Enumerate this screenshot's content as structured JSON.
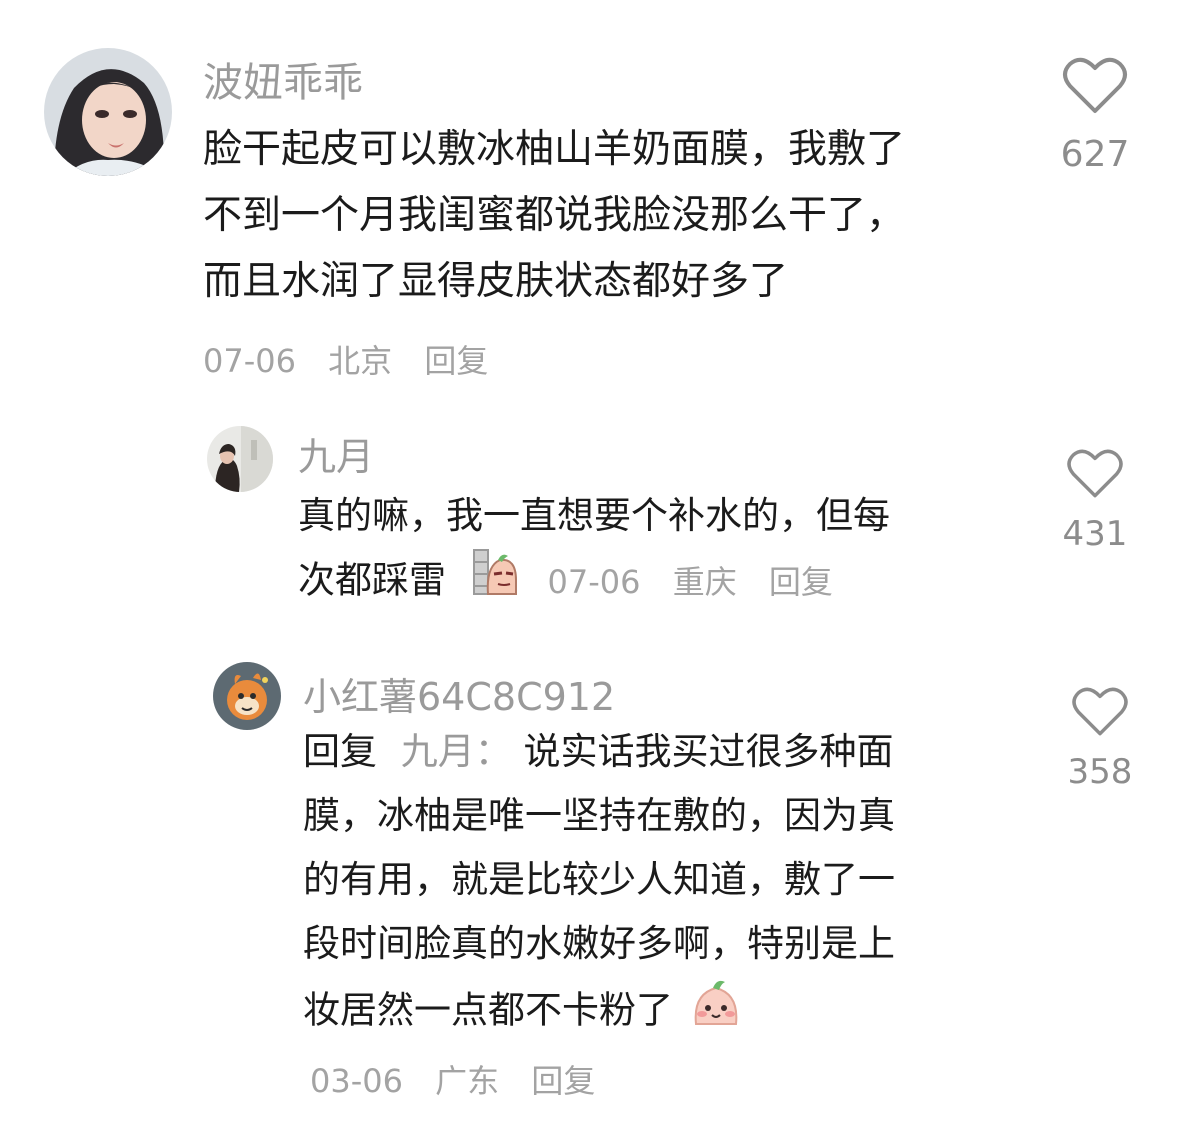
{
  "comments": [
    {
      "username": "波妞乖乖",
      "avatar_icon": "anime-girl-avatar-icon",
      "lines": [
        "脸干起皮可以敷冰柚山羊奶面膜，我敷了",
        "不到一个月我闺蜜都说我脸没那么干了，",
        "而且水润了显得皮肤状态都好多了"
      ],
      "date": "07-06",
      "location": "北京",
      "reply_label": "回复",
      "like_count": "627"
    },
    {
      "username": "九月",
      "avatar_icon": "photo-avatar-icon",
      "lines": [
        "真的嘛，我一直想要个补水的，但每",
        "次都踩雷"
      ],
      "emoji_icon": "peeking-wall-emoji-icon",
      "date": "07-06",
      "location": "重庆",
      "reply_label": "回复",
      "like_count": "431"
    },
    {
      "username": "小红薯64C8C912",
      "avatar_icon": "cartoon-mascot-avatar-icon",
      "reply_prefix": "回复",
      "reply_to": "九月：",
      "lines": [
        "说实话我买过很多种面",
        "膜，冰柚是唯一坚持在敷的，因为真",
        "的有用，就是比较少人知道，敷了一",
        "段时间脸真的水嫩好多啊，特别是上",
        "妆居然一点都不卡粉了"
      ],
      "emoji_icon": "blushing-face-emoji-icon",
      "date": "03-06",
      "location": "广东",
      "reply_label": "回复",
      "like_count": "358"
    }
  ],
  "colors": {
    "text": "#1b1b1b",
    "username": "#9a9a9a",
    "meta": "#a3a3a3",
    "like_icon": "#8c8c8c"
  }
}
